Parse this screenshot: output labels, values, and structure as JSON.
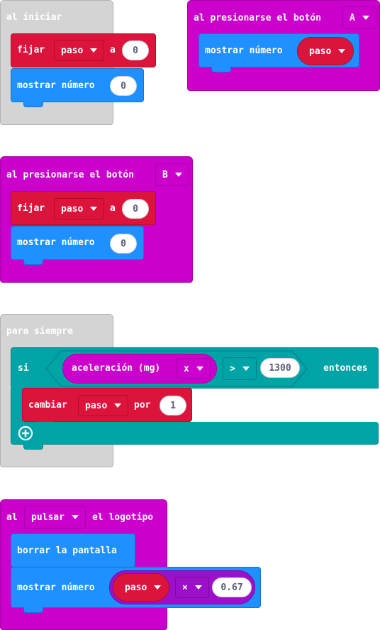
{
  "colors": {
    "gray_hat": "#d4d4d4",
    "purple_hat": "#cc00cc",
    "variables_red": "#dc143c",
    "basic_blue": "#1e90ff",
    "logic_teal": "#00a4a6",
    "math_purple": "#9b10c8"
  },
  "on_start": {
    "title": "al iniciar",
    "set_block": {
      "keyword": "fijar",
      "variable": "paso",
      "to_word": "a",
      "value": "0"
    },
    "show_number": {
      "label": "mostrar número",
      "value": "0"
    }
  },
  "button_a": {
    "title": "al presionarse el botón",
    "button": "A",
    "show_number": {
      "label": "mostrar número",
      "variable": "paso"
    }
  },
  "button_b": {
    "title": "al presionarse el botón",
    "button": "B",
    "set_block": {
      "keyword": "fijar",
      "variable": "paso",
      "to_word": "a",
      "value": "0"
    },
    "show_number": {
      "label": "mostrar número",
      "value": "0"
    }
  },
  "forever": {
    "title": "para siempre",
    "if_block": {
      "if_word": "si",
      "sensor": "aceleración (mg)",
      "axis": "x",
      "operator": ">",
      "threshold": "1300",
      "then_word": "entonces",
      "add_icon": "plus-circle-icon"
    },
    "change_block": {
      "keyword": "cambiar",
      "variable": "paso",
      "by_word": "por",
      "value": "1"
    }
  },
  "logo": {
    "title_prefix": "al",
    "event": "pulsar",
    "title_suffix": "el logotipo",
    "clear_screen": {
      "label": "borrar la pantalla"
    },
    "show_number": {
      "label": "mostrar número",
      "variable": "paso",
      "operator": "×",
      "value": "0.67"
    }
  }
}
